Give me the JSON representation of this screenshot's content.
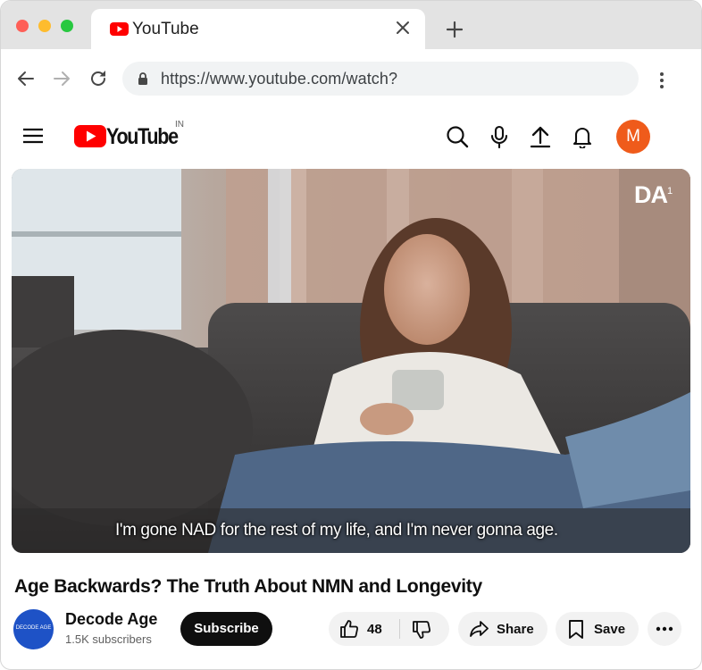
{
  "browser": {
    "tab_title": "YouTube",
    "url": "https://www.youtube.com/watch?"
  },
  "youtube_header": {
    "logo_text": "YouTube",
    "country_code": "IN",
    "avatar_initial": "M",
    "avatar_color": "#ef5b1b"
  },
  "video": {
    "watermark": "DA",
    "watermark_sup": "1",
    "caption": "I'm gone NAD for the rest of my life, and I'm never gonna age."
  },
  "details": {
    "title": "Age Backwards? The Truth About NMN and Longevity",
    "channel_name": "Decode Age",
    "channel_avatar_text": "DECODE AGE",
    "subscribers": "1.5K subscribers",
    "subscribe_label": "Subscribe",
    "like_count": "48",
    "share_label": "Share",
    "save_label": "Save"
  },
  "colors": {
    "youtube_red": "#ff0000",
    "subscribe_bg": "#0f0f0f",
    "pill_bg": "#f2f2f2",
    "channel_avatar_bg": "#1e52c6"
  },
  "icons": {
    "tab_favicon": "youtube-favicon-icon",
    "tab_close": "close-icon",
    "new_tab": "plus-icon",
    "back": "arrow-left-icon",
    "forward": "arrow-right-icon",
    "reload": "reload-icon",
    "lock": "lock-icon",
    "browser_menu": "vertical-dots-icon",
    "menu": "hamburger-icon",
    "search": "search-icon",
    "mic": "microphone-icon",
    "upload": "upload-icon",
    "notifications": "bell-icon",
    "like": "thumbs-up-icon",
    "dislike": "thumbs-down-icon",
    "share": "share-arrow-icon",
    "save": "bookmark-icon",
    "more": "horizontal-dots-icon"
  }
}
